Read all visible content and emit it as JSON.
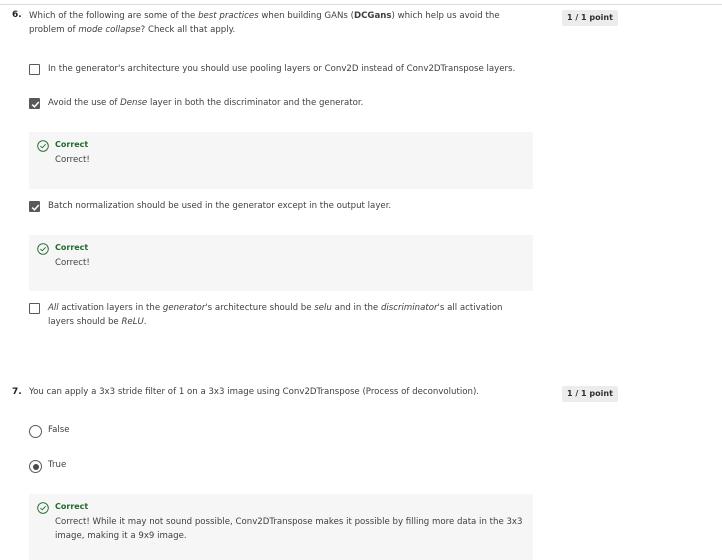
{
  "q6": {
    "number": "6.",
    "text": {
      "p1": "Which of the following are some of the ",
      "em1": "best practices",
      "p2": " when building GANs (",
      "strong1": "DCGans",
      "p3": ") which help us avoid the problem of ",
      "em2": "mode collapse",
      "p4": "? Check all that apply."
    },
    "points": "1 / 1 point",
    "options": [
      {
        "label": "In the generator's architecture you should use pooling layers or Conv2D instead of Conv2DTranspose layers.",
        "checked": false
      },
      {
        "label_parts": [
          "Avoid the use of ",
          "Dense",
          " layer in both the discriminator and the generator."
        ],
        "checked": true,
        "feedback": {
          "title": "Correct",
          "text": "Correct!"
        }
      },
      {
        "label": "Batch normalization should be used in the generator except in the output layer.",
        "checked": true,
        "feedback": {
          "title": "Correct",
          "text": "Correct!"
        }
      },
      {
        "label_parts": [
          "All",
          " activation layers in the ",
          "generator",
          "'s architecture should be ",
          "selu",
          " and in the ",
          "discriminator",
          "'s all activation layers should be ",
          "ReLU",
          "."
        ],
        "checked": false
      }
    ]
  },
  "q7": {
    "number": "7.",
    "text": "You can apply a 3x3 stride filter of 1 on a 3x3 image using Conv2DTranspose (Process of deconvolution).",
    "points": "1 / 1 point",
    "options": [
      {
        "label": "False",
        "selected": false
      },
      {
        "label": "True",
        "selected": true
      }
    ],
    "feedback": {
      "title": "Correct",
      "text": "Correct! While it may not sound possible, Conv2DTranspose makes it possible by filling more data in the 3x3 image, making it a 9x9 image."
    }
  },
  "colors": {
    "correct": "#1f6a2b",
    "feedback_bg": "#f5f6f5",
    "badge_bg": "#ececec",
    "checkbox": "#595959"
  }
}
